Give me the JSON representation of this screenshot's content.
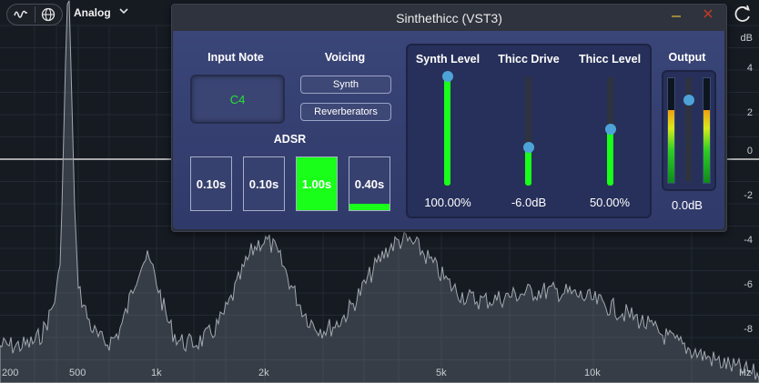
{
  "analyzer": {
    "mode_label": "Analog",
    "db_labels": [
      "dB",
      "4",
      "2",
      "0",
      "-2",
      "-4",
      "-6",
      "-8"
    ],
    "hz_labels": [
      "200",
      "500",
      "1k",
      "2k",
      "5k",
      "10k",
      "Hz"
    ]
  },
  "plugin": {
    "title": "Sinthethicc (VST3)",
    "input_note": {
      "label": "Input Note",
      "value": "C4"
    },
    "voicing": {
      "label": "Voicing",
      "options": [
        "Synth",
        "Reverberators"
      ]
    },
    "adsr": {
      "label": "ADSR",
      "values": [
        "0.10s",
        "0.10s",
        "1.00s",
        "0.40s"
      ],
      "fill_fractions": [
        0,
        0,
        1.0,
        0.12
      ]
    },
    "sliders": [
      {
        "label": "Synth Level",
        "value": "100.00%",
        "fraction": 1.0
      },
      {
        "label": "Thicc Drive",
        "value": "-6.0dB",
        "fraction": 0.35
      },
      {
        "label": "Thicc Level",
        "value": "50.00%",
        "fraction": 0.52
      }
    ],
    "output": {
      "label": "Output",
      "value": "0.0dB",
      "fraction": 0.78,
      "meter_left": 0.7,
      "meter_right": 0.7
    }
  },
  "colors": {
    "accent_green": "#19ff19",
    "knob_blue": "#4da3d8",
    "panel_blue": "#3a4578",
    "note_green": "#27e233"
  }
}
